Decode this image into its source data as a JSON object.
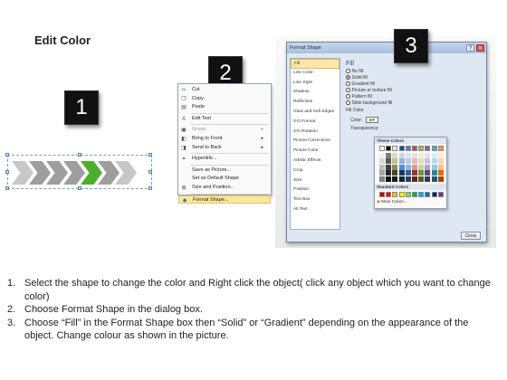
{
  "title": "Edit Color",
  "badges": [
    "1",
    "2",
    "3"
  ],
  "arrows": {
    "colors": {
      "gray": "#9e9e9e",
      "gray_light": "#c7c7c7",
      "green": "#4caf2c"
    },
    "count": 7
  },
  "context_menu": {
    "items": [
      {
        "label": "Cut",
        "icon": "scissors-icon",
        "glyph": "✂",
        "disabled": false
      },
      {
        "label": "Copy",
        "icon": "copy-icon",
        "glyph": "❐",
        "disabled": false
      },
      {
        "label": "Paste",
        "icon": "paste-icon",
        "glyph": "▤",
        "disabled": false
      },
      {
        "label": "Edit Text",
        "icon": "edit-text-icon",
        "glyph": "A",
        "disabled": false
      },
      {
        "label": "Group",
        "icon": "group-icon",
        "glyph": "▣",
        "disabled": true,
        "submenu": true
      },
      {
        "label": "Bring to Front",
        "icon": "bring-front-icon",
        "glyph": "◧",
        "disabled": false,
        "submenu": true
      },
      {
        "label": "Send to Back",
        "icon": "send-back-icon",
        "glyph": "◨",
        "disabled": false,
        "submenu": true
      },
      {
        "label": "Hyperlink...",
        "icon": "hyperlink-icon",
        "glyph": "⚭",
        "disabled": false
      },
      {
        "label": "Save as Picture...",
        "icon": "",
        "glyph": "",
        "disabled": false
      },
      {
        "label": "Set as Default Shape",
        "icon": "",
        "glyph": "",
        "disabled": false
      },
      {
        "label": "Size and Position...",
        "icon": "size-position-icon",
        "glyph": "⊞",
        "disabled": false
      },
      {
        "label": "Format Shape...",
        "icon": "format-shape-icon",
        "glyph": "◆",
        "disabled": false,
        "highlight": true
      }
    ]
  },
  "dialog": {
    "title": "Format Shape",
    "help_btn": "?",
    "close_x": "✕",
    "categories": [
      "Fill",
      "Line Color",
      "Line Style",
      "Shadow",
      "Reflection",
      "Glow and Soft Edges",
      "3-D Format",
      "3-D Rotation",
      "Picture Corrections",
      "Picture Color",
      "Artistic Effects",
      "Crop",
      "Size",
      "Position",
      "Text Box",
      "Alt Text"
    ],
    "selected_category": "Fill",
    "section_heading": "Fill",
    "options": [
      "No fill",
      "Solid fill",
      "Gradient fill",
      "Picture or texture fill",
      "Pattern fill",
      "Slide background fill"
    ],
    "selected_option": "Solid fill",
    "fill_color_label": "Fill Color",
    "color_label": "Color:",
    "transparency_label": "Transparency:",
    "close_button": "Close"
  },
  "color_popup": {
    "theme_colors_label": "Theme Colors",
    "standard_colors_label": "Standard Colors",
    "more_colors_label": "More Colors...",
    "theme_top": [
      "#ffffff",
      "#000000",
      "#eeece1",
      "#1f497d",
      "#4f81bd",
      "#c0504d",
      "#9bbb59",
      "#8064a2",
      "#4bacc6",
      "#f79646"
    ],
    "theme_columns": [
      [
        "#f2f2f2",
        "#d8d8d8",
        "#bfbfbf",
        "#a5a5a5",
        "#7f7f7f"
      ],
      [
        "#7f7f7f",
        "#595959",
        "#3f3f3f",
        "#262626",
        "#0c0c0c"
      ],
      [
        "#ddd9c3",
        "#c4bd97",
        "#938953",
        "#494429",
        "#1d1b10"
      ],
      [
        "#c6d9f0",
        "#8db3e2",
        "#548dd4",
        "#17365d",
        "#0f243e"
      ],
      [
        "#dbe5f1",
        "#b8cce4",
        "#95b3d7",
        "#366092",
        "#244061"
      ],
      [
        "#f2dcdb",
        "#e5b9b7",
        "#d99694",
        "#953734",
        "#632423"
      ],
      [
        "#ebf1dd",
        "#d7e3bc",
        "#c3d69b",
        "#76923c",
        "#4f6128"
      ],
      [
        "#e5e0ec",
        "#ccc1d9",
        "#b2a2c7",
        "#5f497a",
        "#3f3151"
      ],
      [
        "#dbeef3",
        "#b7dde8",
        "#92cddc",
        "#31859b",
        "#205867"
      ],
      [
        "#fdeada",
        "#fbd5b5",
        "#fac08f",
        "#e36c09",
        "#974806"
      ]
    ],
    "standard": [
      "#c00000",
      "#ff0000",
      "#ffc000",
      "#ffff00",
      "#92d050",
      "#00b050",
      "#00b0f0",
      "#0070c0",
      "#002060",
      "#7030a0"
    ]
  },
  "instructions": [
    {
      "num": "1.",
      "text": "Select the shape to change the color and Right click the object( click any object which you want to change color)"
    },
    {
      "num": "2.",
      "text": "Choose Format Shape in the dialog box."
    },
    {
      "num": "3.",
      "text": "Choose “Fill” in the Format Shape box then “Solid” or “Gradient” depending on the appearance of the object. Change colour as shown in the picture."
    }
  ]
}
